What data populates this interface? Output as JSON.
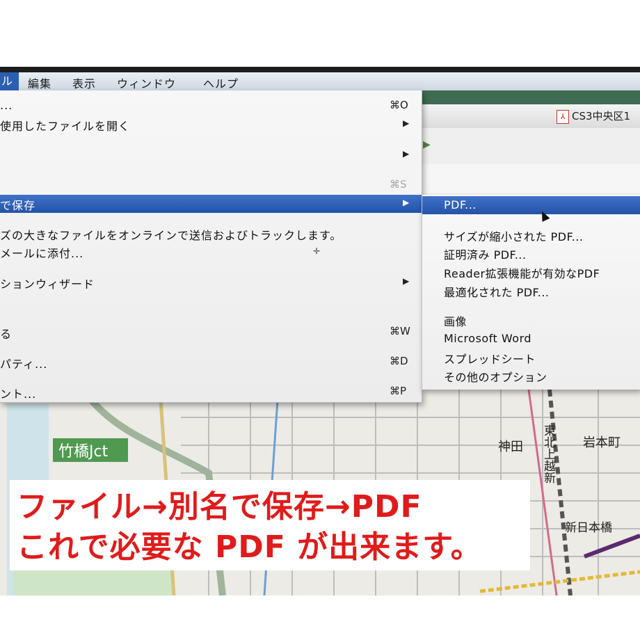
{
  "menubar": {
    "items": [
      {
        "label": "ル",
        "active": true
      },
      {
        "label": "編集"
      },
      {
        "label": "表示"
      },
      {
        "label": "ウィンドウ"
      },
      {
        "label": "ヘルプ"
      }
    ]
  },
  "app": {
    "document_tab": "CS3中央区1"
  },
  "file_menu": {
    "items": [
      {
        "label": "...",
        "shortcut": "⌘O"
      },
      {
        "label": "使用したファイルを開く",
        "submenu": true
      },
      {
        "label": "",
        "submenu": true
      },
      {
        "label": "",
        "shortcut": "⌘S",
        "disabled_shortcut": true
      },
      {
        "label": "で保存",
        "submenu": true,
        "highlighted": true
      },
      {
        "label": "ズの大きなファイルをオンラインで送信およびトラックします。"
      },
      {
        "label": "メールに添付..."
      },
      {
        "label": "ションウィザード",
        "submenu": true
      },
      {
        "label": "る",
        "shortcut": "⌘W"
      },
      {
        "label": "パティ...",
        "shortcut": "⌘D"
      },
      {
        "label": "ント...",
        "shortcut": "⌘P"
      }
    ]
  },
  "save_as_submenu": {
    "items": [
      {
        "label": "PDF...",
        "highlighted": true
      },
      {
        "label": "サイズが縮小された PDF..."
      },
      {
        "label": "証明済み PDF..."
      },
      {
        "label": "Reader拡張機能が有効なPDF"
      },
      {
        "label": "最適化された PDF..."
      },
      {
        "label": "画像"
      },
      {
        "label": "Microsoft Word"
      },
      {
        "label": "スプレッドシート"
      },
      {
        "label": "その他のオプション"
      }
    ]
  },
  "map_labels": {
    "junction": "竹橋Jct",
    "kanda": "神田",
    "iwamotocho": "岩本町",
    "line": "東北上越新",
    "shin_nihonbashi": "新日本橋"
  },
  "caption": {
    "line1": "ファイル→別名で保存→PDF",
    "line2": "これで必要な PDF が出来ます。"
  },
  "colors": {
    "highlight": "#2c5fb3",
    "caption_red": "#e01b1b",
    "junction_green": "#4f9a50"
  }
}
